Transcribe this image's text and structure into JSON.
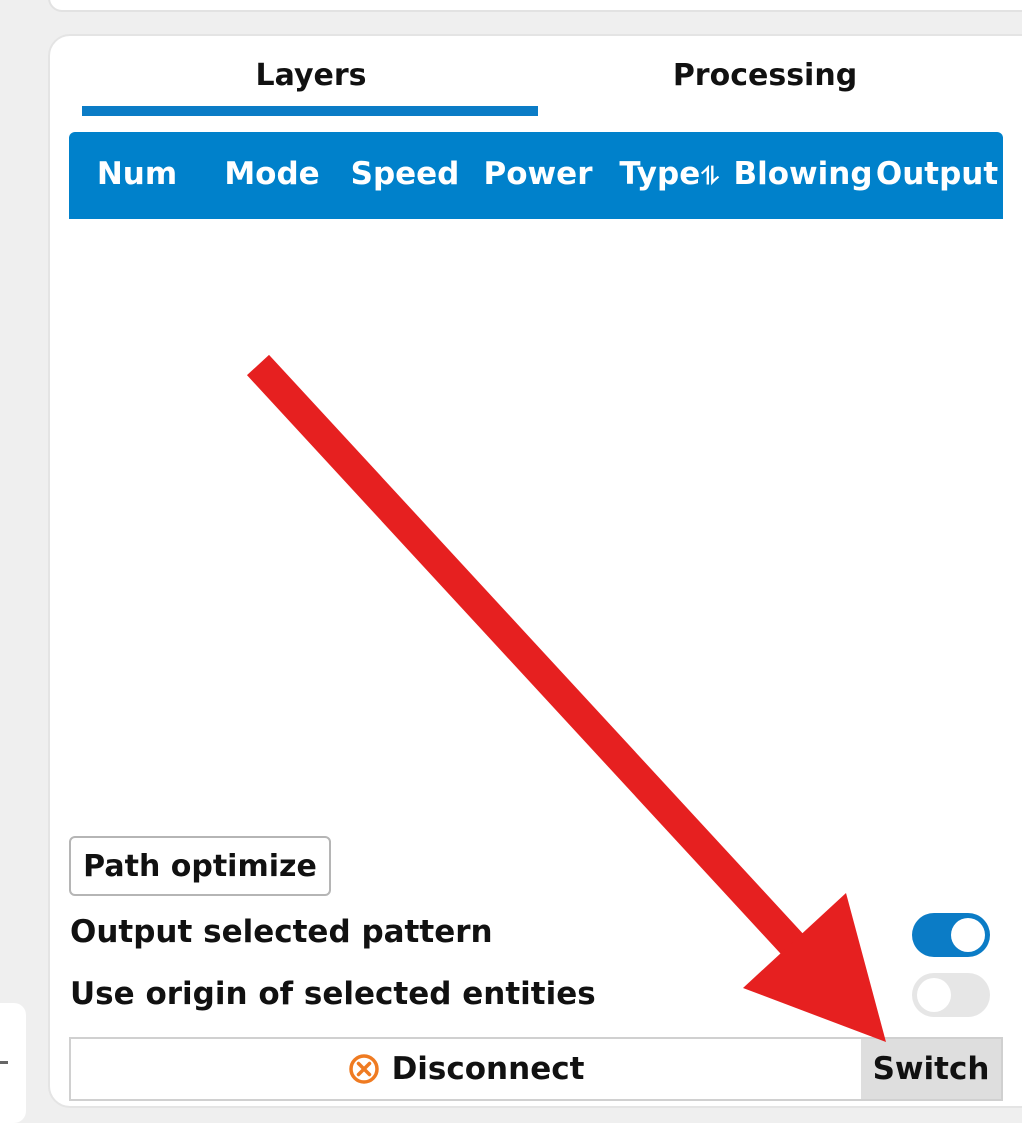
{
  "tabs": [
    {
      "label": "Layers",
      "active": true
    },
    {
      "label": "Processing",
      "active": false
    }
  ],
  "table": {
    "columns": [
      "Num",
      "Mode",
      "Speed",
      "Power",
      "Type",
      "Blowing",
      "Output"
    ],
    "sortable_column": "Type",
    "rows": []
  },
  "actions": {
    "path_optimize": "Path optimize"
  },
  "options": {
    "output_selected": {
      "label": "Output selected pattern",
      "on": true
    },
    "use_origin": {
      "label": "Use origin of selected entities",
      "on": false
    }
  },
  "bottom": {
    "disconnect": "Disconnect",
    "switch": "Switch"
  },
  "colors": {
    "accent": "#0081cb",
    "disconnect_icon": "#ef7b22",
    "annotation_arrow": "#e62020"
  },
  "icons": {
    "sort": "sort-arrows-icon",
    "disconnect": "close-circle-icon",
    "annotation": "red-arrow-annotation-icon"
  },
  "sort_glyph": "⥮"
}
